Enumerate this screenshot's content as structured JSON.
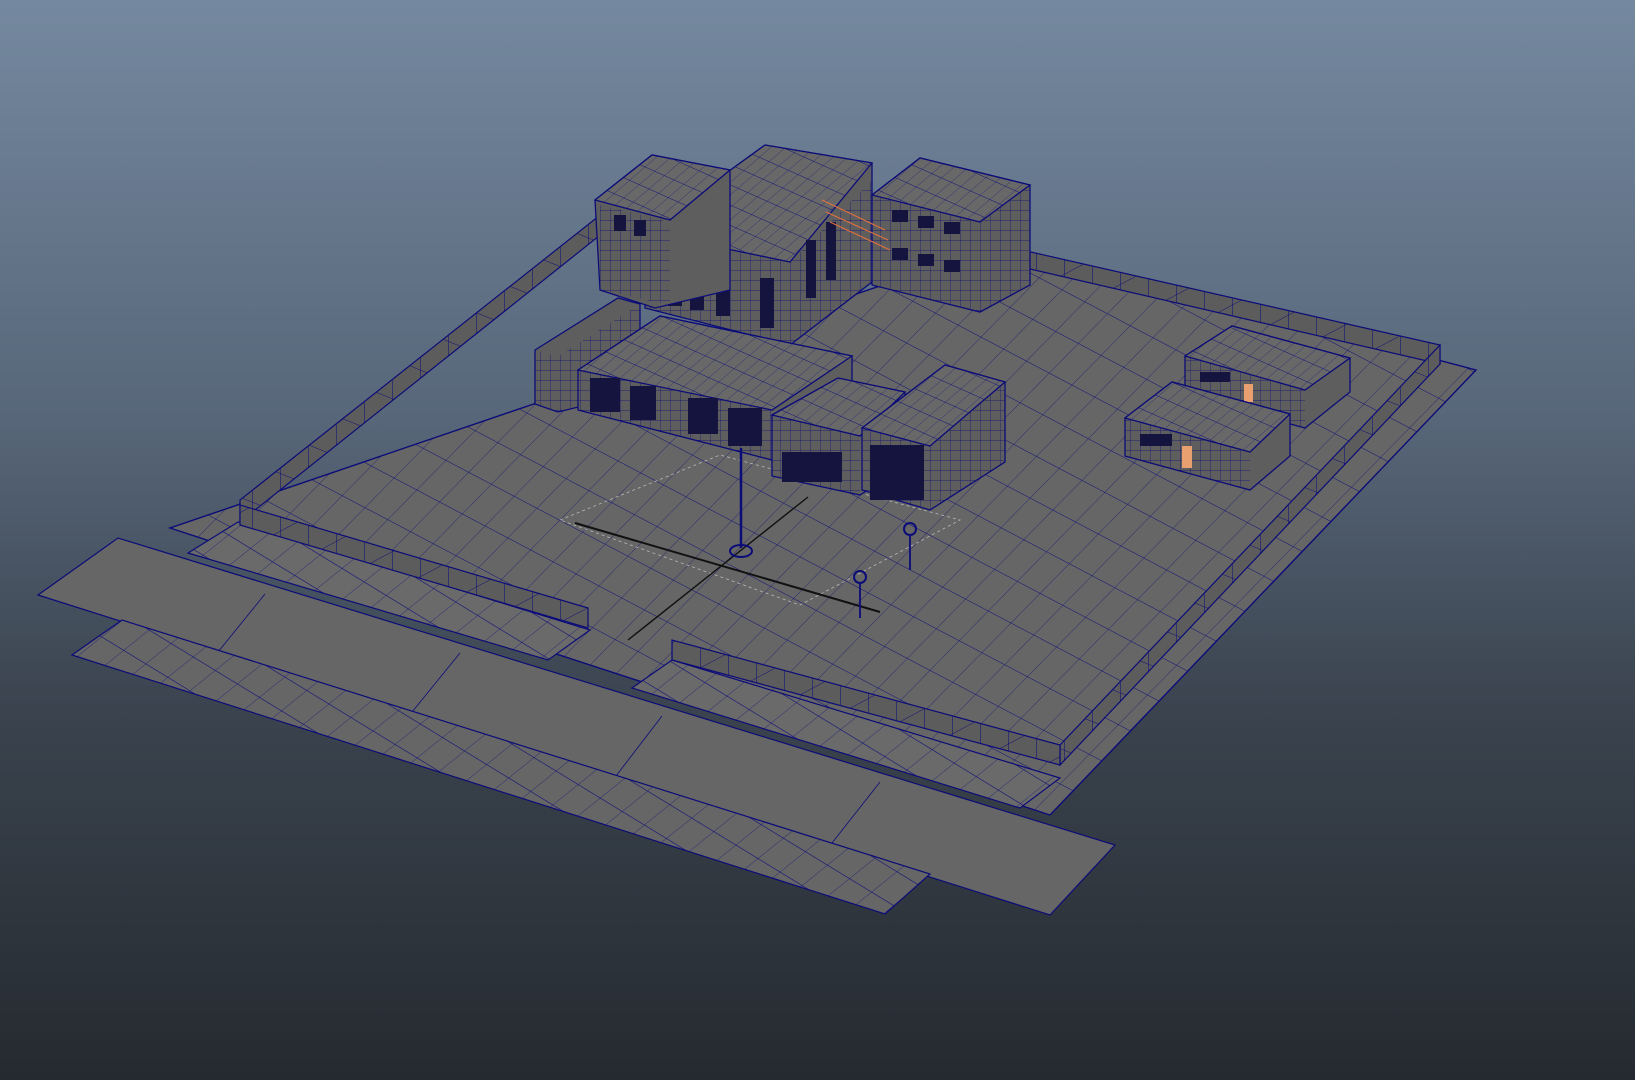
{
  "viewport": {
    "mode": "wireframe-on-shaded",
    "background": "gradient",
    "colors": {
      "top": "#74889f",
      "bottom": "#252a30",
      "ground": "#666666",
      "building": "#646464",
      "wire": "#0c0c78",
      "selected": "#e07040",
      "window_glow": "#e8a070",
      "grid": "#b8b8b8",
      "axis": "#111111"
    }
  },
  "scene": {
    "objects": [
      "ground-plane",
      "road-strip",
      "sidewalk-front",
      "sidewalk-left",
      "fence-left",
      "fence-back",
      "fence-right",
      "fence-front-left",
      "fence-front-right",
      "main-building-tall",
      "main-building-left-wing",
      "annex-building",
      "lobby-block",
      "center-block",
      "right-block",
      "corner-block",
      "small-building-a",
      "small-building-b",
      "flagpole",
      "sign-post-a",
      "sign-post-b",
      "origin-grid"
    ]
  }
}
